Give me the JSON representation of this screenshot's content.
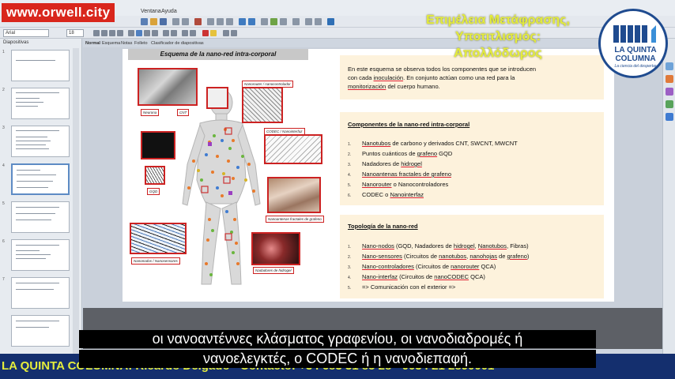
{
  "watermark": {
    "text": "www.orwell.city"
  },
  "menubar": {
    "items": [
      "Ventana",
      "Ayuda"
    ]
  },
  "toolbar": {
    "font_name": "Arial",
    "font_size": "18"
  },
  "slides_panel": {
    "title": "Diapositivas",
    "slide_numbers": [
      "1",
      "2",
      "3",
      "4",
      "5",
      "6",
      "7"
    ]
  },
  "tabs": [
    "Normal",
    "Esquema",
    "Notas",
    "Folleto",
    "Clasificador de diapositivas"
  ],
  "overlay": {
    "title_lines": [
      "Επιμέλεια Μετάφρασης,",
      "Υποτιτλισμός:",
      "Απολλόδωρος"
    ],
    "logo_name_1": "LA QUINTA",
    "logo_name_2": "COLUMNA",
    "logo_tagline": "La ciencia del despertar"
  },
  "slide": {
    "diagram_title": "Esquema de la nano-red intra-corporal",
    "photo_labels": {
      "neurona": "Neurona",
      "cnt": "CNT",
      "nanorouter": "Nanorouter / nanocontrolador",
      "codec": "CODEC / Nanointerfaz",
      "gqd": "GQD",
      "nanoantenas": "Nanoantenas fractales de grafeno",
      "nanonodos": "Nanonodos / Nanosensores",
      "nadadores": "Nadadores de hidrogel"
    },
    "intro_text": {
      "line1": "En este esquema se observa todos los componentes que se introducen",
      "line2_a": "con cada ",
      "line2_b": "inoculación",
      "line2_c": ". En conjunto actúan como una red para la",
      "line3_a": "monitorización",
      "line3_b": " del cuerpo humano."
    },
    "components": {
      "heading": "Componentes de la nano-red intra-corporal",
      "items": [
        {
          "a": "Nanotubos",
          "b": " de carbono y derivados CNT, SWCNT, MWCNT"
        },
        {
          "a": "Puntos cuánticos de ",
          "b": "grafeno",
          "c": " GQD"
        },
        {
          "a": "Nadadores de ",
          "b": "hidrogel"
        },
        {
          "a": "Nanoantenas fractales de grafeno"
        },
        {
          "a": "Nanorouter",
          "b": " o Nanocontroladores"
        },
        {
          "a": "CODEC o ",
          "b": "Nanointerfaz"
        }
      ]
    },
    "topology": {
      "heading": "Topología de la nano-red",
      "items": [
        {
          "a": "Nano-nodos",
          "b": " (GQD, Nadadores de ",
          "c": "hidrogel",
          "d": ", ",
          "e": "Nanotubos",
          "f": ", Fibras)"
        },
        {
          "a": "Nano-sensores",
          "b": " (Circuitos de ",
          "c": "nanotubos",
          "d": ", ",
          "e": "nanohojas",
          "f": " de ",
          "g": "grafeno",
          "h": ")"
        },
        {
          "a": "Nano-controladores",
          "b": " (Circuitos de ",
          "c": "nanorouter",
          "d": " QCA)"
        },
        {
          "a": "Nano-interfaz",
          "b": " (Circuitos de ",
          "c": "nanoCODEC",
          "d": " QCA)"
        },
        {
          "a": "=> Comunicación con el exterior =>"
        }
      ]
    }
  },
  "subtitles": {
    "line1": "οι νανοαντέννες κλάσματος γραφενίου, οι νανοδιαδρομές ή",
    "line2": "νανοελεγκτές, ο CODEC ή η νανοδιεπαφή."
  },
  "ticker": {
    "text": "LA QUINTA COLUMNA: Ricardo Delgado - Contacto: +34 683 31 85 28 - 0034 21 2890001"
  },
  "colors": {
    "watermark_bg": "#d9261c",
    "overlay_title": "#e4ec3c",
    "logo_blue": "#1f4b8f",
    "panel_bg": "#fdf2dc",
    "photo_border": "#cc2222",
    "ticker_bg": "#142f6e"
  }
}
